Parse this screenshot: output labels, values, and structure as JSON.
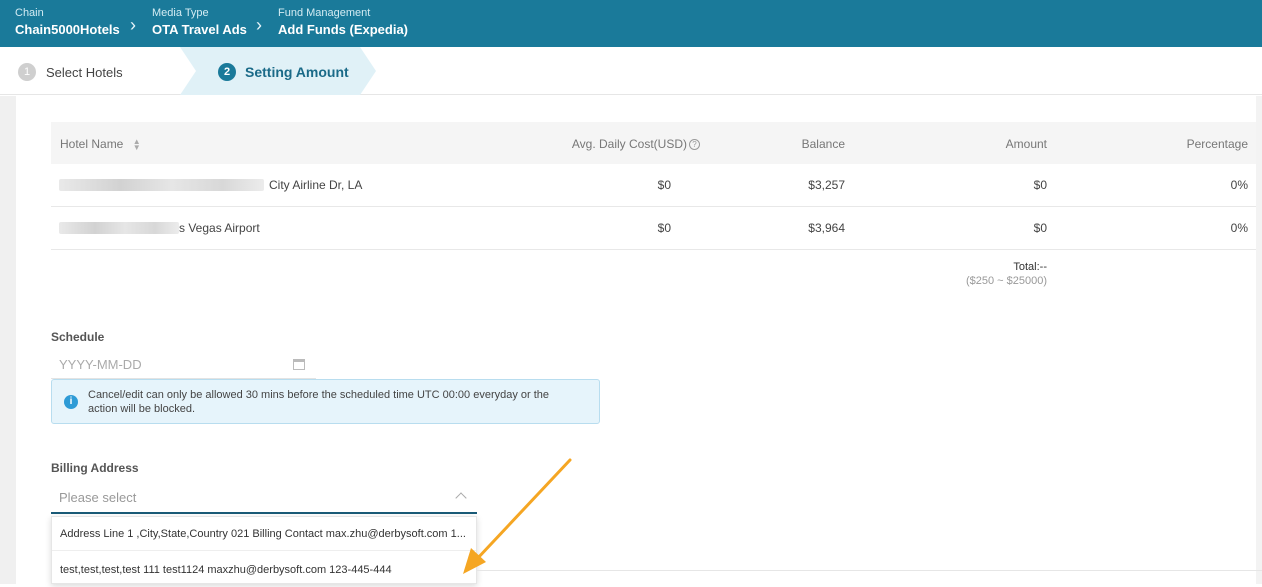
{
  "breadcrumb": [
    {
      "label": "Chain",
      "value": "Chain5000Hotels"
    },
    {
      "label": "Media Type",
      "value": "OTA Travel Ads"
    },
    {
      "label": "Fund Management",
      "value": "Add Funds (Expedia)"
    }
  ],
  "steps": [
    {
      "number": "1",
      "label": "Select Hotels"
    },
    {
      "number": "2",
      "label": "Setting Amount"
    }
  ],
  "table": {
    "headers": {
      "hotel_name": "Hotel Name",
      "avg_daily_cost": "Avg. Daily Cost(USD)",
      "balance": "Balance",
      "amount": "Amount",
      "percentage": "Percentage"
    },
    "rows": [
      {
        "hotel_name": "City Airline Dr, LA",
        "avg_daily_cost": "$0",
        "balance": "$3,257",
        "amount": "$0",
        "percentage": "0%"
      },
      {
        "hotel_name": "s Vegas Airport",
        "avg_daily_cost": "$0",
        "balance": "$3,964",
        "amount": "$0",
        "percentage": "0%"
      }
    ],
    "total_label": "Total:--",
    "total_range": "($250 ~ $25000)"
  },
  "schedule": {
    "label": "Schedule",
    "placeholder": "YYYY-MM-DD",
    "notice": "Cancel/edit can only be allowed 30 mins before the scheduled time UTC 00:00 everyday or the action will be blocked."
  },
  "billing": {
    "label": "Billing Address",
    "placeholder": "Please select",
    "options": [
      "Address Line 1 ,City,State,Country 021 Billing Contact max.zhu@derbysoft.com 1...",
      "test,test,test,test 111 test1124 maxzhu@derbysoft.com 123-445-444"
    ]
  },
  "colors": {
    "header": "#1a7a9a",
    "accent": "#1a6a88",
    "arrow": "#f5a623"
  }
}
